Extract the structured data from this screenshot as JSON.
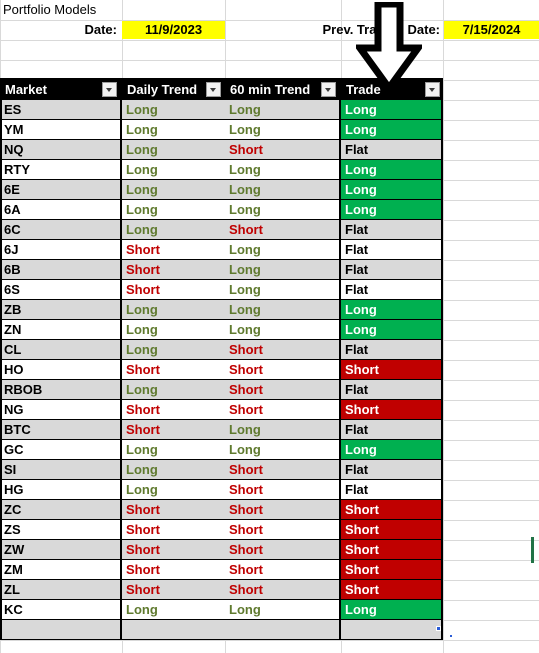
{
  "sheet": {
    "title": "Portfolio Models",
    "date_label": "Date:",
    "date_value": "11/9/2023",
    "prev_date_label": "Prev. Trading Date:",
    "prev_date_value": "7/15/2024"
  },
  "colors": {
    "header_bg": "#000000",
    "header_text": "#ffffff",
    "highlight": "#ffff00",
    "long_text": "#5f7a2e",
    "short_text": "#c00000",
    "long_fill": "#00b050",
    "short_fill": "#c00000",
    "band_gray": "#d9d9d9"
  },
  "table": {
    "columns": [
      {
        "label": "Market",
        "filter_icon": "filter-dropdown-icon"
      },
      {
        "label": "Daily Trend",
        "filter_icon": "filter-dropdown-icon"
      },
      {
        "label": "60 min Trend",
        "filter_icon": "filter-dropdown-icon"
      },
      {
        "label": "Trade",
        "filter_icon": "filter-dropdown-icon"
      }
    ],
    "rows": [
      {
        "market": "ES",
        "daily": "Long",
        "hour": "Long",
        "trade": "Long"
      },
      {
        "market": "YM",
        "daily": "Long",
        "hour": "Long",
        "trade": "Long"
      },
      {
        "market": "NQ",
        "daily": "Long",
        "hour": "Short",
        "trade": "Flat"
      },
      {
        "market": "RTY",
        "daily": "Long",
        "hour": "Long",
        "trade": "Long"
      },
      {
        "market": "6E",
        "daily": "Long",
        "hour": "Long",
        "trade": "Long"
      },
      {
        "market": "6A",
        "daily": "Long",
        "hour": "Long",
        "trade": "Long"
      },
      {
        "market": "6C",
        "daily": "Long",
        "hour": "Short",
        "trade": "Flat"
      },
      {
        "market": "6J",
        "daily": "Short",
        "hour": "Long",
        "trade": "Flat"
      },
      {
        "market": "6B",
        "daily": "Short",
        "hour": "Long",
        "trade": "Flat"
      },
      {
        "market": "6S",
        "daily": "Short",
        "hour": "Long",
        "trade": "Flat"
      },
      {
        "market": "ZB",
        "daily": "Long",
        "hour": "Long",
        "trade": "Long"
      },
      {
        "market": "ZN",
        "daily": "Long",
        "hour": "Long",
        "trade": "Long"
      },
      {
        "market": "CL",
        "daily": "Long",
        "hour": "Short",
        "trade": "Flat"
      },
      {
        "market": "HO",
        "daily": "Short",
        "hour": "Short",
        "trade": "Short"
      },
      {
        "market": "RBOB",
        "daily": "Long",
        "hour": "Short",
        "trade": "Flat"
      },
      {
        "market": "NG",
        "daily": "Short",
        "hour": "Short",
        "trade": "Short"
      },
      {
        "market": "BTC",
        "daily": "Short",
        "hour": "Long",
        "trade": "Flat"
      },
      {
        "market": "GC",
        "daily": "Long",
        "hour": "Long",
        "trade": "Long"
      },
      {
        "market": "SI",
        "daily": "Long",
        "hour": "Short",
        "trade": "Flat"
      },
      {
        "market": "HG",
        "daily": "Long",
        "hour": "Short",
        "trade": "Flat"
      },
      {
        "market": "ZC",
        "daily": "Short",
        "hour": "Short",
        "trade": "Short"
      },
      {
        "market": "ZS",
        "daily": "Short",
        "hour": "Short",
        "trade": "Short"
      },
      {
        "market": "ZW",
        "daily": "Short",
        "hour": "Short",
        "trade": "Short"
      },
      {
        "market": "ZM",
        "daily": "Short",
        "hour": "Short",
        "trade": "Short"
      },
      {
        "market": "ZL",
        "daily": "Short",
        "hour": "Short",
        "trade": "Short"
      },
      {
        "market": "KC",
        "daily": "Long",
        "hour": "Long",
        "trade": "Long"
      },
      {
        "market": "",
        "daily": "",
        "hour": "",
        "trade": ""
      }
    ]
  },
  "annotation": {
    "arrow_icon": "down-arrow-annotation",
    "points_at": "Trade"
  }
}
